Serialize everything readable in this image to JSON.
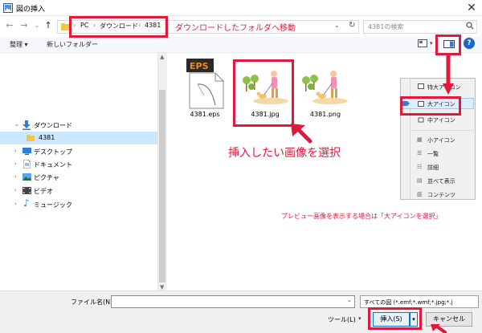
{
  "window": {
    "title": "図の挿入",
    "close": "✕"
  },
  "nav": {
    "back": "←",
    "forward": "→",
    "dropdown": "⌄",
    "up": "↑",
    "breadcrumb": [
      "PC",
      "ダウンロード",
      "4381"
    ],
    "separator": "›",
    "search_placeholder": "4381の検索"
  },
  "toolbar": {
    "organize": "整理 ▾",
    "new_folder": "新しいフォルダー",
    "help": "?"
  },
  "tree": [
    {
      "label": "ダウンロード",
      "arrow": "⌄",
      "icon": "download-arrow-icon",
      "expanded": true
    },
    {
      "label": "4381",
      "arrow": "",
      "icon": "folder-icon",
      "selected": true
    },
    {
      "label": "デスクトップ",
      "arrow": "›",
      "icon": "desktop-icon"
    },
    {
      "label": "ドキュメント",
      "arrow": "›",
      "icon": "document-icon"
    },
    {
      "label": "ピクチャ",
      "arrow": "›",
      "icon": "pictures-icon"
    },
    {
      "label": "ビデオ",
      "arrow": "›",
      "icon": "video-icon"
    },
    {
      "label": "ミュージック",
      "arrow": "›",
      "icon": "music-icon"
    }
  ],
  "files": [
    {
      "name": "4381.eps",
      "badge": "EPS"
    },
    {
      "name": "4381.jpg"
    },
    {
      "name": "4381.png"
    }
  ],
  "view_menu": [
    "特大アイコン",
    "大アイコン",
    "中アイコン",
    "小アイコン",
    "一覧",
    "詳細",
    "並べて表示",
    "コンテンツ"
  ],
  "bottom": {
    "filename_label": "ファイル名(N):",
    "filename_value": "",
    "file_type": "すべての図 (*.emf;*.wmf;*.jpg;*.j",
    "tools": "ツール(L)",
    "insert": "挿入(S)",
    "cancel": "キャンセル"
  },
  "annotations": {
    "folder_note": "ダウンロードしたフォルダへ移動",
    "select_note": "挿入したい画像を選択",
    "preview_note": "プレビュー画像を表示する場合は「大アイコンを選択」"
  },
  "colors": {
    "annotation_red": "#e01a3c",
    "selection_blue": "#cce8ff",
    "accent_blue": "#1769c4"
  }
}
